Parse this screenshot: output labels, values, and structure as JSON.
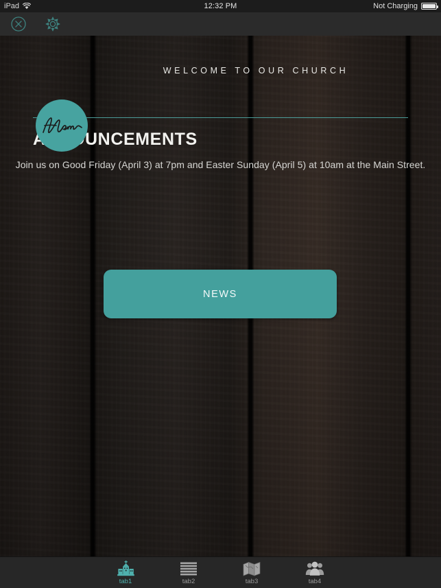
{
  "status_bar": {
    "device": "iPad",
    "wifi_icon": "wifi-icon",
    "time": "12:32 PM",
    "battery_text": "Not Charging",
    "battery_icon": "battery-full-icon"
  },
  "nav_bar": {
    "close_icon": "close-circle-icon",
    "settings_icon": "gear-icon"
  },
  "header": {
    "logo_text": "Horeo",
    "logo_icon": "church-logo-mark",
    "welcome_text": "WELCOME TO OUR CHURCH"
  },
  "main": {
    "announcements_title": "ANNOUNCEMENTS",
    "announcement_body": "Join us on Good Friday (April 3) at 7pm and Easter Sunday (April 5) at 10am at the Main Street.",
    "news_button_label": "NEWS"
  },
  "tab_bar": {
    "tabs": [
      {
        "label": "tab1",
        "icon": "church-building-icon",
        "active": true
      },
      {
        "label": "tab2",
        "icon": "list-lines-icon",
        "active": false
      },
      {
        "label": "tab3",
        "icon": "folded-map-icon",
        "active": false
      },
      {
        "label": "tab4",
        "icon": "people-group-icon",
        "active": false
      }
    ]
  },
  "colors": {
    "accent_teal": "#44a09d",
    "accent_teal_light": "#4fb0ad",
    "background_dark": "#241f1c",
    "tabbar_bg": "#272727",
    "navbar_bg": "#2b2b2b",
    "text_light": "#f2f2ef",
    "text_muted": "#9b9b9b"
  }
}
